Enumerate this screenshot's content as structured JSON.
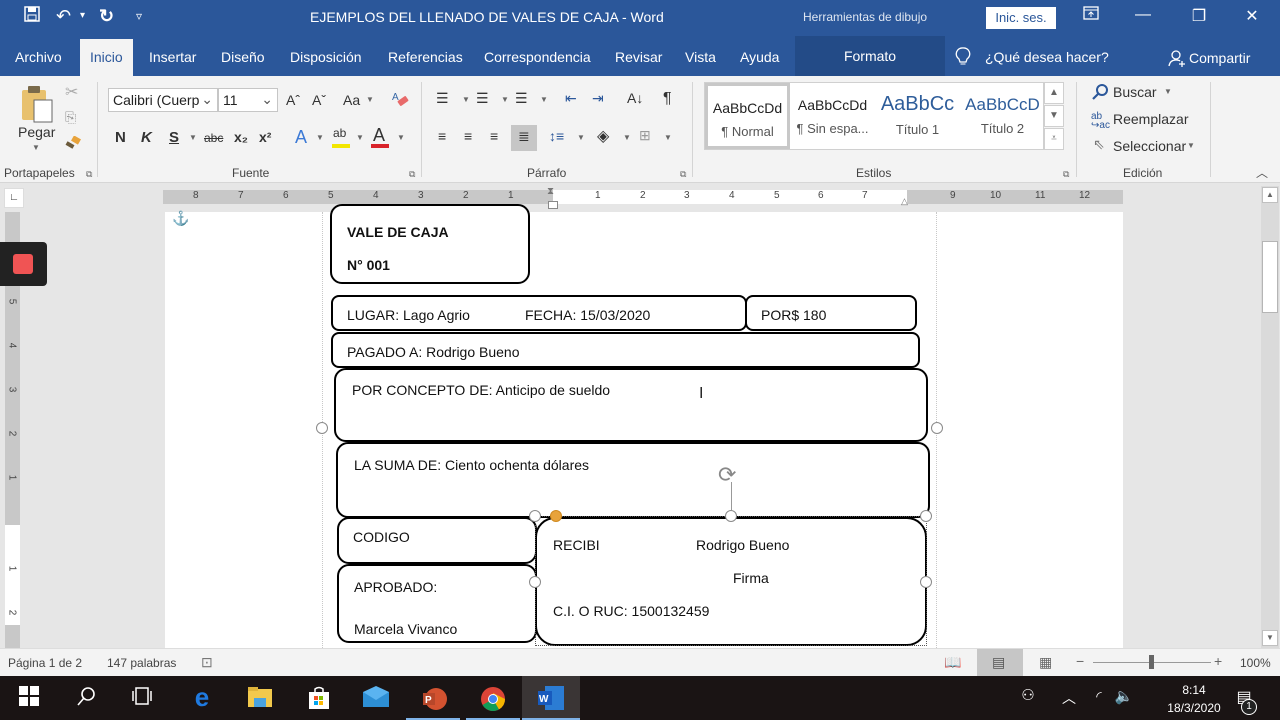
{
  "titlebar": {
    "title": "EJEMPLOS DEL LLENADO DE VALES DE CAJA  -  Word",
    "context_tools": "Herramientas de dibujo",
    "signin": "Inic. ses.",
    "qat": {
      "save": "💾",
      "undo": "↶",
      "undo_dropdown": "▾",
      "redo": "↻",
      "customize": "▿"
    },
    "window": {
      "ribbon_display": "⭱",
      "minimize": "—",
      "restore": "❐",
      "close": "✕"
    }
  },
  "tabs": {
    "items": [
      "Archivo",
      "Inicio",
      "Insertar",
      "Diseño",
      "Disposición",
      "Referencias",
      "Correspondencia",
      "Revisar",
      "Vista",
      "Ayuda"
    ],
    "active": "Inicio",
    "context_tab": "Formato",
    "tell_me": "¿Qué desea hacer?",
    "share": "Compartir"
  },
  "ribbon": {
    "clipboard": {
      "paste": "Pegar",
      "label": "Portapapeles"
    },
    "font": {
      "name": "Calibri (Cuerp",
      "size": "11",
      "label": "Fuente",
      "grow": "Aˆ",
      "shrink": "Aˇ",
      "case": "Aa",
      "bold": "N",
      "italic": "K",
      "underline": "S",
      "strike": "abc",
      "sub": "x₂",
      "sup": "x²",
      "effects": "A",
      "highlight": "ab",
      "color": "A",
      "highlight_color": "#f2e600",
      "font_color": "#d9232b"
    },
    "paragraph": {
      "label": "Párrafo",
      "pilcrow": "¶",
      "sort": "A↓"
    },
    "styles": {
      "label": "Estilos",
      "items": [
        {
          "preview": "AaBbCcDd",
          "name": "¶ Normal"
        },
        {
          "preview": "AaBbCcDd",
          "name": "¶ Sin espa..."
        },
        {
          "preview": "AaBbCc",
          "name": "Título 1"
        },
        {
          "preview": "AaBbCcD",
          "name": "Título 2"
        }
      ]
    },
    "editing": {
      "label": "Edición",
      "find": "Buscar",
      "replace": "Reemplazar",
      "select": "Seleccionar"
    }
  },
  "ruler": {
    "h_left": [
      "8",
      "7",
      "6",
      "5",
      "4",
      "3",
      "2",
      "1"
    ],
    "h_right": [
      "1",
      "2",
      "3",
      "4",
      "5",
      "6",
      "7"
    ],
    "h_margin": [
      "9",
      "10",
      "11",
      "12"
    ],
    "v_ticks": [
      "5",
      "4",
      "3",
      "2",
      "1",
      "1",
      "2"
    ]
  },
  "document": {
    "header_box": {
      "title": "VALE DE CAJA",
      "number": "N° 001"
    },
    "lugar": "LUGAR: Lago Agrio",
    "fecha": "FECHA:  15/03/2020",
    "por": "POR$ 180",
    "pagado": "PAGADO  A: Rodrigo Bueno",
    "concepto": "POR CONCEPTO DE:  Anticipo de sueldo",
    "suma": "LA SUMA DE:  Ciento ochenta dólares",
    "codigo": "CODIGO",
    "aprobado_label": "APROBADO:",
    "aprobado_name": "Marcela Vivanco",
    "recibi": "RECIBI",
    "recibi_name": "Rodrigo Bueno",
    "firma": "Firma",
    "ci": "C.I. O RUC: 1500132459"
  },
  "status": {
    "page": "Página 1 de 2",
    "words": "147 palabras",
    "zoom": "100%",
    "zoom_level_percent": 100
  },
  "taskbar": {
    "time": "8:14",
    "date": "18/3/2020",
    "notifications": "1"
  }
}
